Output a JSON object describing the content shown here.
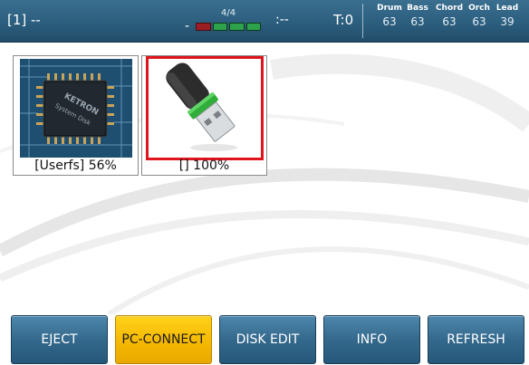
{
  "header": {
    "song": "[1] --",
    "bars": "-",
    "time_signature": "4/4",
    "key": ":--",
    "transpose": "T:0",
    "mixer": [
      {
        "name": "Drum",
        "value": "63"
      },
      {
        "name": "Bass",
        "value": "63"
      },
      {
        "name": "Chord",
        "value": "63"
      },
      {
        "name": "Orch",
        "value": "63"
      },
      {
        "name": "Lead",
        "value": "39"
      }
    ]
  },
  "drives": [
    {
      "label": "[Userfs] 56%",
      "icon": "internal-disk-chip-icon",
      "selected": false
    },
    {
      "label": "[] 100%",
      "icon": "usb-drive-icon",
      "selected": true
    }
  ],
  "footer": {
    "buttons": [
      {
        "label": "EJECT",
        "active": false
      },
      {
        "label": "PC-CONNECT",
        "active": true
      },
      {
        "label": "DISK EDIT",
        "active": false
      },
      {
        "label": "INFO",
        "active": false
      },
      {
        "label": "REFRESH",
        "active": false
      }
    ]
  },
  "colors": {
    "header": "#2c5e7e",
    "button": "#34698c",
    "active_button": "#f4b600",
    "selection": "#e0141c"
  }
}
